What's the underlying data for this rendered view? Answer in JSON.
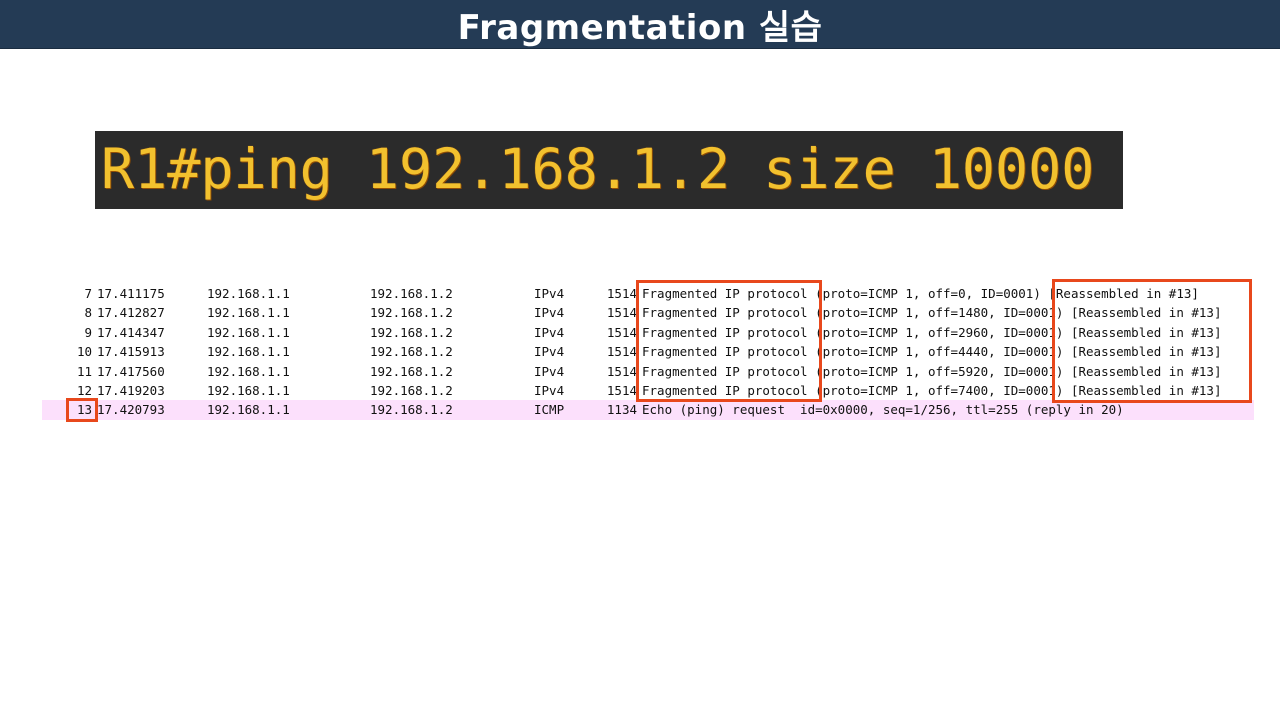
{
  "slide": {
    "title": "Fragmentation 실습"
  },
  "terminal": {
    "command": "R1#ping 192.168.1.2 size 10000"
  },
  "packets": [
    {
      "no": "7",
      "time": "17.411175",
      "source": "192.168.1.1",
      "destination": "192.168.1.2",
      "protocol": "IPv4",
      "length": "1514",
      "info": "Fragmented IP protocol (proto=ICMP 1, off=0, ID=0001) [Reassembled in #13]"
    },
    {
      "no": "8",
      "time": "17.412827",
      "source": "192.168.1.1",
      "destination": "192.168.1.2",
      "protocol": "IPv4",
      "length": "1514",
      "info": "Fragmented IP protocol (proto=ICMP 1, off=1480, ID=0001) [Reassembled in #13]"
    },
    {
      "no": "9",
      "time": "17.414347",
      "source": "192.168.1.1",
      "destination": "192.168.1.2",
      "protocol": "IPv4",
      "length": "1514",
      "info": "Fragmented IP protocol (proto=ICMP 1, off=2960, ID=0001) [Reassembled in #13]"
    },
    {
      "no": "10",
      "time": "17.415913",
      "source": "192.168.1.1",
      "destination": "192.168.1.2",
      "protocol": "IPv4",
      "length": "1514",
      "info": "Fragmented IP protocol (proto=ICMP 1, off=4440, ID=0001) [Reassembled in #13]"
    },
    {
      "no": "11",
      "time": "17.417560",
      "source": "192.168.1.1",
      "destination": "192.168.1.2",
      "protocol": "IPv4",
      "length": "1514",
      "info": "Fragmented IP protocol (proto=ICMP 1, off=5920, ID=0001) [Reassembled in #13]"
    },
    {
      "no": "12",
      "time": "17.419203",
      "source": "192.168.1.1",
      "destination": "192.168.1.2",
      "protocol": "IPv4",
      "length": "1514",
      "info": "Fragmented IP protocol (proto=ICMP 1, off=7400, ID=0001) [Reassembled in #13]"
    },
    {
      "no": "13",
      "time": "17.420793",
      "source": "192.168.1.1",
      "destination": "192.168.1.2",
      "protocol": "ICMP",
      "length": "1134",
      "info": "Echo (ping) request  id=0x0000, seq=1/256, ttl=255 (reply in 20)"
    }
  ],
  "colors": {
    "title_bg": "#243b55",
    "terminal_bg": "#2b2b2b",
    "terminal_text": "#f2c12e",
    "highlight_box": "#e8481c",
    "icmp_row_bg": "#fce0fc"
  }
}
